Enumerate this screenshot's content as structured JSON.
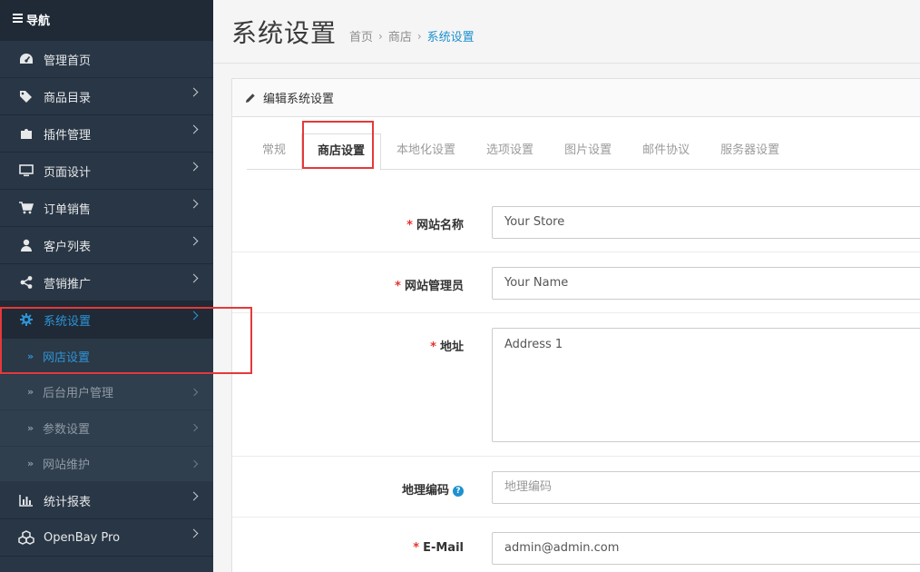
{
  "sidebar": {
    "header": "导航",
    "items": [
      {
        "label": "管理首页",
        "icon": "dashboard-icon",
        "chevron": false
      },
      {
        "label": "商品目录",
        "icon": "tags-icon",
        "chevron": true
      },
      {
        "label": "插件管理",
        "icon": "puzzle-icon",
        "chevron": true
      },
      {
        "label": "页面设计",
        "icon": "desktop-icon",
        "chevron": true
      },
      {
        "label": "订单销售",
        "icon": "cart-icon",
        "chevron": true
      },
      {
        "label": "客户列表",
        "icon": "user-icon",
        "chevron": true
      },
      {
        "label": "营销推广",
        "icon": "share-icon",
        "chevron": true
      },
      {
        "label": "系统设置",
        "icon": "gear-icon",
        "chevron": true,
        "active": true
      }
    ],
    "sub_items": [
      {
        "label": "网店设置",
        "active": true,
        "chevron": false
      },
      {
        "label": "后台用户管理",
        "chevron": true
      },
      {
        "label": "参数设置",
        "chevron": true
      },
      {
        "label": "网站维护",
        "chevron": true
      }
    ],
    "bottom_items": [
      {
        "label": "统计报表",
        "icon": "bar-chart-icon"
      },
      {
        "label": "OpenBay Pro",
        "icon": "cubes-icon"
      }
    ]
  },
  "page": {
    "title": "系统设置",
    "breadcrumb": [
      "首页",
      "商店",
      "系统设置"
    ],
    "panel_title": "编辑系统设置"
  },
  "tabs": [
    "常规",
    "商店设置",
    "本地化设置",
    "选项设置",
    "图片设置",
    "邮件协议",
    "服务器设置"
  ],
  "form": {
    "store_name": {
      "label": "网站名称",
      "value": "Your Store"
    },
    "owner": {
      "label": "网站管理员",
      "value": "Your Name"
    },
    "address": {
      "label": "地址",
      "value": "Address 1"
    },
    "geocode": {
      "label": "地理编码",
      "placeholder": "地理编码"
    },
    "email": {
      "label": "E-Mail",
      "value": "admin@admin.com"
    }
  },
  "colors": {
    "sidebar_bg": "#293645",
    "accent": "#1e91cf",
    "highlight": "#e5393b",
    "required": "#e3342f"
  }
}
